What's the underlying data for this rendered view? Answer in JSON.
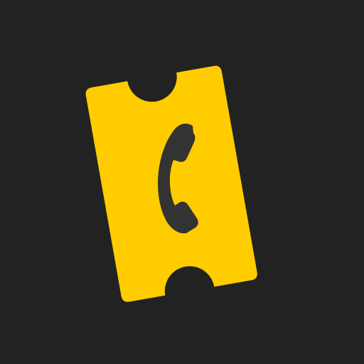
{
  "icon": {
    "name": "ticket-phone-app-icon",
    "background_color": "#222222",
    "ticket_color": "#FFCC00",
    "phone_color": "#333333",
    "ticket_icon": "ticket-icon",
    "phone_icon": "phone-handset-icon"
  }
}
